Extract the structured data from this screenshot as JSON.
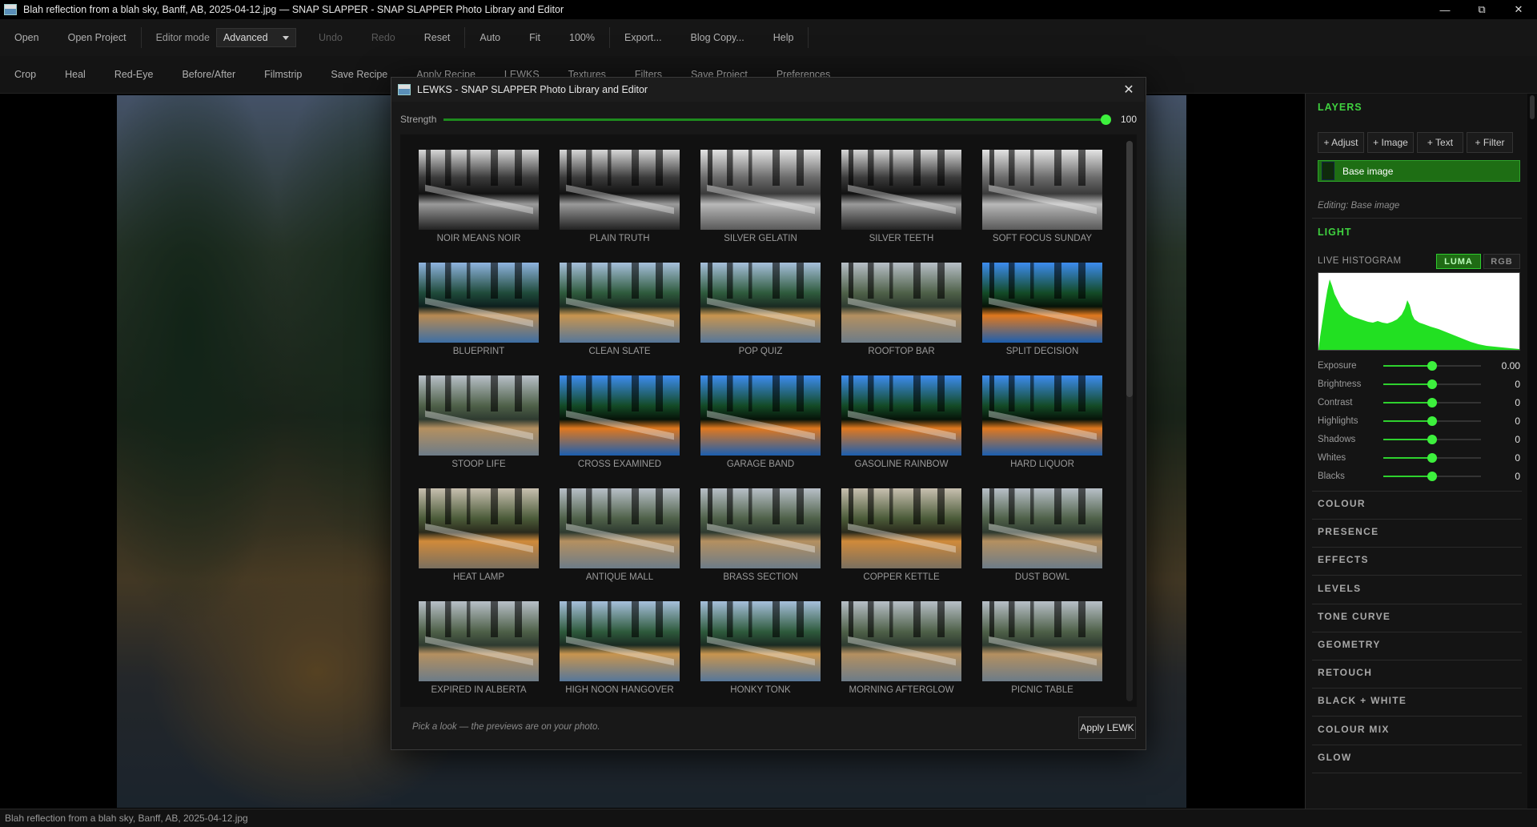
{
  "window": {
    "title": "Blah reflection from a blah sky, Banff, AB, 2025-04-12.jpg — SNAP SLAPPER - SNAP SLAPPER Photo Library and Editor",
    "minimize_icon": "minimize-icon",
    "maximize_icon": "restore-icon",
    "close_icon": "close-icon"
  },
  "toolbar1": {
    "open": "Open",
    "open_project": "Open Project",
    "editor_mode_label": "Editor mode",
    "editor_mode_value": "Advanced",
    "undo": "Undo",
    "redo": "Redo",
    "reset": "Reset",
    "auto": "Auto",
    "fit": "Fit",
    "zoom": "100%",
    "export": "Export...",
    "blog_copy": "Blog Copy...",
    "help": "Help"
  },
  "toolbar2": {
    "crop": "Crop",
    "heal": "Heal",
    "red_eye": "Red-Eye",
    "before_after": "Before/After",
    "filmstrip": "Filmstrip",
    "save_recipe": "Save Recipe",
    "apply_recipe": "Apply Recipe",
    "lewks": "LEWKS",
    "textures": "Textures",
    "filters": "Filters",
    "save_project": "Save Project",
    "preferences": "Preferences"
  },
  "status_bar": {
    "filename": "Blah reflection from a blah sky, Banff, AB, 2025-04-12.jpg"
  },
  "side_panel": {
    "layers_title": "LAYERS",
    "add_buttons": [
      "+ Adjust",
      "+ Image",
      "+ Text",
      "+ Filter"
    ],
    "base_layer": "Base image",
    "editing": "Editing: Base image",
    "light_title": "LIGHT",
    "histogram_label": "LIVE HISTOGRAM",
    "luma": "LUMA",
    "rgb": "RGB",
    "histogram_color": "#22e022",
    "sliders": [
      {
        "name": "Exposure",
        "value": "0.00",
        "level": 0.5
      },
      {
        "name": "Brightness",
        "value": "0",
        "level": 0.5
      },
      {
        "name": "Contrast",
        "value": "0",
        "level": 0.5
      },
      {
        "name": "Highlights",
        "value": "0",
        "level": 0.5
      },
      {
        "name": "Shadows",
        "value": "0",
        "level": 0.5
      },
      {
        "name": "Whites",
        "value": "0",
        "level": 0.5
      },
      {
        "name": "Blacks",
        "value": "0",
        "level": 0.5
      }
    ],
    "sections": [
      "COLOUR",
      "PRESENCE",
      "EFFECTS",
      "LEVELS",
      "TONE CURVE",
      "GEOMETRY",
      "RETOUCH",
      "BLACK + WHITE",
      "COLOUR MIX",
      "GLOW"
    ]
  },
  "dialog": {
    "title": "LEWKS - SNAP SLAPPER Photo Library and Editor",
    "strength_label": "Strength",
    "strength_value": "100",
    "strength_level": 1.0,
    "hint": "Pick a look — the previews are on your photo.",
    "apply": "Apply LEWK",
    "looks": [
      {
        "name": "NOIR MEANS NOIR",
        "style": "bw"
      },
      {
        "name": "PLAIN TRUTH",
        "style": "bw"
      },
      {
        "name": "SILVER GELATIN",
        "style": "bw-soft"
      },
      {
        "name": "SILVER TEETH",
        "style": "bw"
      },
      {
        "name": "SOFT FOCUS SUNDAY",
        "style": "bw-soft"
      },
      {
        "name": "BLUEPRINT",
        "style": "cool"
      },
      {
        "name": "CLEAN SLATE",
        "style": "natural"
      },
      {
        "name": "POP QUIZ",
        "style": "natural"
      },
      {
        "name": "ROOFTOP BAR",
        "style": "muted"
      },
      {
        "name": "SPLIT DECISION",
        "style": "vivid"
      },
      {
        "name": "STOOP LIFE",
        "style": "muted"
      },
      {
        "name": "CROSS EXAMINED",
        "style": "vivid"
      },
      {
        "name": "GARAGE BAND",
        "style": "vivid"
      },
      {
        "name": "GASOLINE RAINBOW",
        "style": "vivid"
      },
      {
        "name": "HARD LIQUOR",
        "style": "vivid"
      },
      {
        "name": "HEAT LAMP",
        "style": "warm"
      },
      {
        "name": "ANTIQUE MALL",
        "style": "muted"
      },
      {
        "name": "BRASS SECTION",
        "style": "muted"
      },
      {
        "name": "COPPER KETTLE",
        "style": "warm"
      },
      {
        "name": "DUST BOWL",
        "style": "muted"
      },
      {
        "name": "EXPIRED IN ALBERTA",
        "style": "muted"
      },
      {
        "name": "HIGH NOON HANGOVER",
        "style": "natural"
      },
      {
        "name": "HONKY TONK",
        "style": "natural"
      },
      {
        "name": "MORNING AFTERGLOW",
        "style": "muted"
      },
      {
        "name": "PICNIC TABLE",
        "style": "muted"
      }
    ]
  }
}
